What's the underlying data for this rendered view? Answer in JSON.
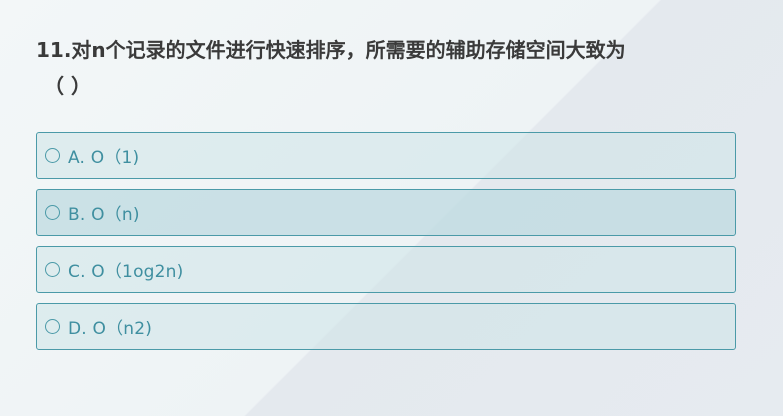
{
  "question": {
    "text": "11.对n个记录的文件进行快速排序，所需要的辅助存储空间大致为",
    "paren": "（ ）"
  },
  "options": [
    {
      "label": "A. O（1)"
    },
    {
      "label": "B. O（n)"
    },
    {
      "label": "C. O（1og2n)"
    },
    {
      "label": "D. O（n2)"
    }
  ],
  "colors": {
    "accent": "#4b9aa8",
    "option_text": "#3f8fa0",
    "question_text": "#3a3a3a"
  }
}
